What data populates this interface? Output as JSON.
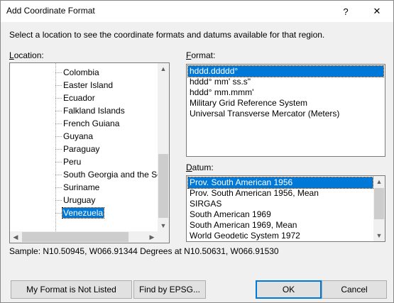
{
  "window": {
    "title": "Add Coordinate Format",
    "help_label": "?",
    "close_label": "✕"
  },
  "instructions": "Select a location to see the coordinate formats and datums available for that region.",
  "location": {
    "label_prefix": "",
    "label_underlined": "L",
    "label_rest": "ocation:",
    "items": [
      {
        "label": "Colombia"
      },
      {
        "label": "Easter Island"
      },
      {
        "label": "Ecuador"
      },
      {
        "label": "Falkland Islands"
      },
      {
        "label": "French Guiana"
      },
      {
        "label": "Guyana"
      },
      {
        "label": "Paraguay"
      },
      {
        "label": "Peru"
      },
      {
        "label": "South Georgia and the South"
      },
      {
        "label": "Suriname"
      },
      {
        "label": "Uruguay"
      },
      {
        "label": "Venezuela"
      }
    ],
    "selected_index": 11
  },
  "format": {
    "label_underlined": "F",
    "label_rest": "ormat:",
    "items": [
      {
        "label": "hddd.ddddd°"
      },
      {
        "label": "hddd° mm' ss.s\""
      },
      {
        "label": "hddd° mm.mmm'"
      },
      {
        "label": "Military Grid Reference System"
      },
      {
        "label": "Universal Transverse Mercator (Meters)"
      }
    ],
    "selected_index": 0
  },
  "datum": {
    "label_underlined": "D",
    "label_rest": "atum:",
    "items": [
      {
        "label": "Prov. South American 1956"
      },
      {
        "label": "Prov. South American 1956, Mean"
      },
      {
        "label": "SIRGAS"
      },
      {
        "label": "South American 1969"
      },
      {
        "label": "South American 1969, Mean"
      },
      {
        "label": "World Geodetic System 1972"
      }
    ],
    "selected_index": 0
  },
  "sample_text": "Sample: N10.50945, W066.91344 Degrees at N10.50631, W066.91530",
  "buttons": {
    "not_listed": "My Format is Not Listed",
    "find_epsg": "Find by EPSG...",
    "ok": "OK",
    "cancel": "Cancel"
  },
  "icons": {
    "scroll_up": "▲",
    "scroll_down": "▼",
    "scroll_left": "◀",
    "scroll_right": "▶"
  }
}
